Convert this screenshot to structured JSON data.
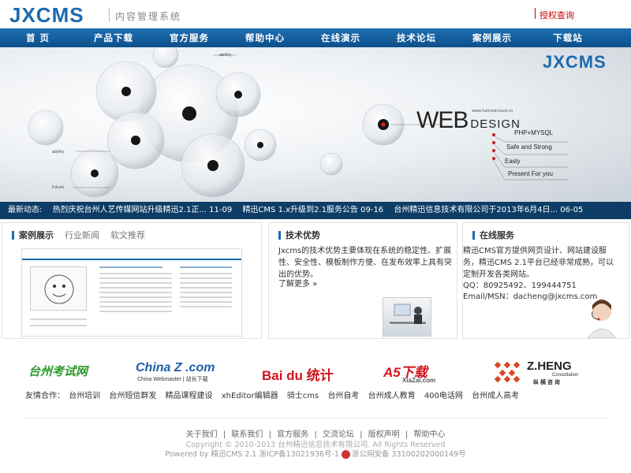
{
  "header": {
    "logo": "JXCMS",
    "subtitle": "内容管理系统",
    "auth_link": "授权查询"
  },
  "nav": [
    "首  页",
    "产品下载",
    "官方服务",
    "帮助中心",
    "在线演示",
    "技术论坛",
    "案例展示",
    "下载站"
  ],
  "banner": {
    "logo": "JXCMS",
    "headline_web": "WEB",
    "headline_design": "DESIGN",
    "url": "www.hainowcloud.cn",
    "tags": [
      "PHP+MYSQL",
      "Safe and Strong",
      "Easly",
      "Present For you"
    ],
    "small_labels": [
      "ability",
      "future",
      "ability"
    ]
  },
  "ticker": {
    "label": "最新动态:",
    "items": [
      "热烈庆祝台州人艺传媒网站升级精迅2.1正... 11-09",
      "精迅CMS 1.x升级到2.1服务公告 09-16",
      "台州精迅信息技术有限公司于2013年6月4日... 06-05"
    ]
  },
  "cases": {
    "tabs": [
      "案例展示",
      "行业新闻",
      "软文推荐"
    ]
  },
  "tech": {
    "title": "技术优势",
    "body": "Jxcms的技术优势主要体现在系统的稳定性、扩展性、安全性、模板制作方便、在发布效率上具有突出的优势。",
    "more": "了解更多 »"
  },
  "service": {
    "title": "在线服务",
    "body": "精迅CMS官方提供网页设计、网站建设服务，精迅CMS 2.1平台已经非常成熟，可以定制开发各类网站。",
    "qq": "QQ：80925492、199444751",
    "email": "Email/MSN：dacheng@jxcms.com"
  },
  "partners": {
    "logos": [
      "台州考试网",
      "China Z .com",
      "China Webmaster | 站长下载",
      "Bai du 统计",
      "A5下载",
      "XiaZai.com",
      "Z.HENG",
      "Consultation",
      "纵 横 咨 询"
    ],
    "links_label": "友情合作：",
    "links": [
      "台州培训",
      "台州短信群发",
      "精品课程建设",
      "xhEditor编辑器",
      "骑士cms",
      "台州自考",
      "台州成人教育",
      "400电话网",
      "台州成人高考"
    ]
  },
  "footer": {
    "links": [
      "关于我们",
      "|",
      "联系我们",
      "|",
      "官方服务",
      "|",
      "交流论坛",
      "|",
      "版权声明",
      "|",
      "帮助中心"
    ],
    "copyright": "Copyright © 2010-2013 台州精迅信息技术有限公司. All Rights Reserved",
    "powered": "Powered by 精迅CMS 2.1 浙ICP备13021936号-1",
    "police": "浙公网安备 33100202000149号"
  },
  "colors": {
    "brand_blue": "#1b6ab0",
    "nav_dark": "#0c4f8a",
    "ticker_bg": "#0d3d66",
    "auth_red": "#cc0000"
  }
}
